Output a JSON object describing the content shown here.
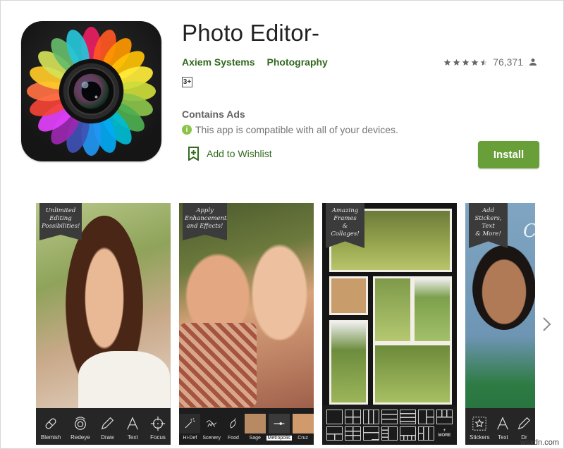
{
  "app": {
    "title": "Photo Editor-",
    "developer": "Axiem Systems",
    "category": "Photography",
    "content_rating": "3+",
    "rating_value": 4.5,
    "rating_count": "76,371",
    "contains_ads": "Contains Ads",
    "compatibility": "This app is compatible with all of your devices.",
    "info_icon_glyph": "i",
    "wishlist_label": "Add to Wishlist",
    "install_label": "Install"
  },
  "colors": {
    "accent_green": "#33691e",
    "install_green": "#689f38",
    "info_green": "#8bc34a"
  },
  "screenshots": [
    {
      "banner": [
        "Unlimited",
        "Editing",
        "Possibilities!"
      ],
      "tools": [
        "Blemish",
        "Redeye",
        "Draw",
        "Text",
        "Focus"
      ]
    },
    {
      "banner": [
        "Apply",
        "Enhancements",
        "and Effects!"
      ],
      "filters": [
        "Hi-Def",
        "Scenery",
        "Food",
        "Sage",
        "Metropolis",
        "Cruz"
      ],
      "selected_filter": "Metropolis"
    },
    {
      "banner": [
        "Amazing",
        "Frames",
        "& Collages!"
      ],
      "more_label": "MORE"
    },
    {
      "banner": [
        "Add Stickers,",
        "Text",
        "& More!"
      ],
      "tools": [
        "Stickers",
        "Text",
        "Dr"
      ]
    }
  ],
  "watermark": "wsxdn.com"
}
